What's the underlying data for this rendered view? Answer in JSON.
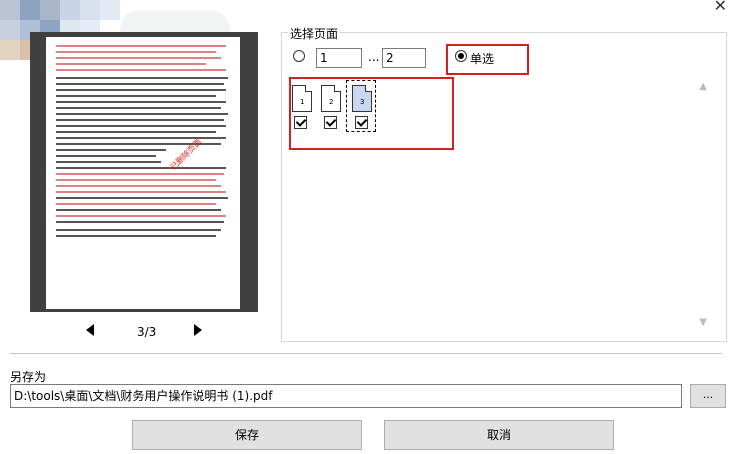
{
  "page_select": {
    "title": "选择页面",
    "range_from": "1",
    "range_sep": "...",
    "range_to": "2",
    "single_label": "单选",
    "pages": [
      {
        "num": "1",
        "checked": true
      },
      {
        "num": "2",
        "checked": true
      },
      {
        "num": "3",
        "checked": true,
        "current": true
      }
    ]
  },
  "preview": {
    "indicator": "3/3",
    "stamp": "已删除页面"
  },
  "save": {
    "label": "另存为",
    "path": "D:\\tools\\桌面\\文档\\财务用户操作说明书 (1).pdf",
    "browse_label": "..."
  },
  "buttons": {
    "save": "保存",
    "cancel": "取消"
  },
  "colors": {
    "highlight": "#d61f1f",
    "selected_thumb": "#c9d8f2"
  }
}
